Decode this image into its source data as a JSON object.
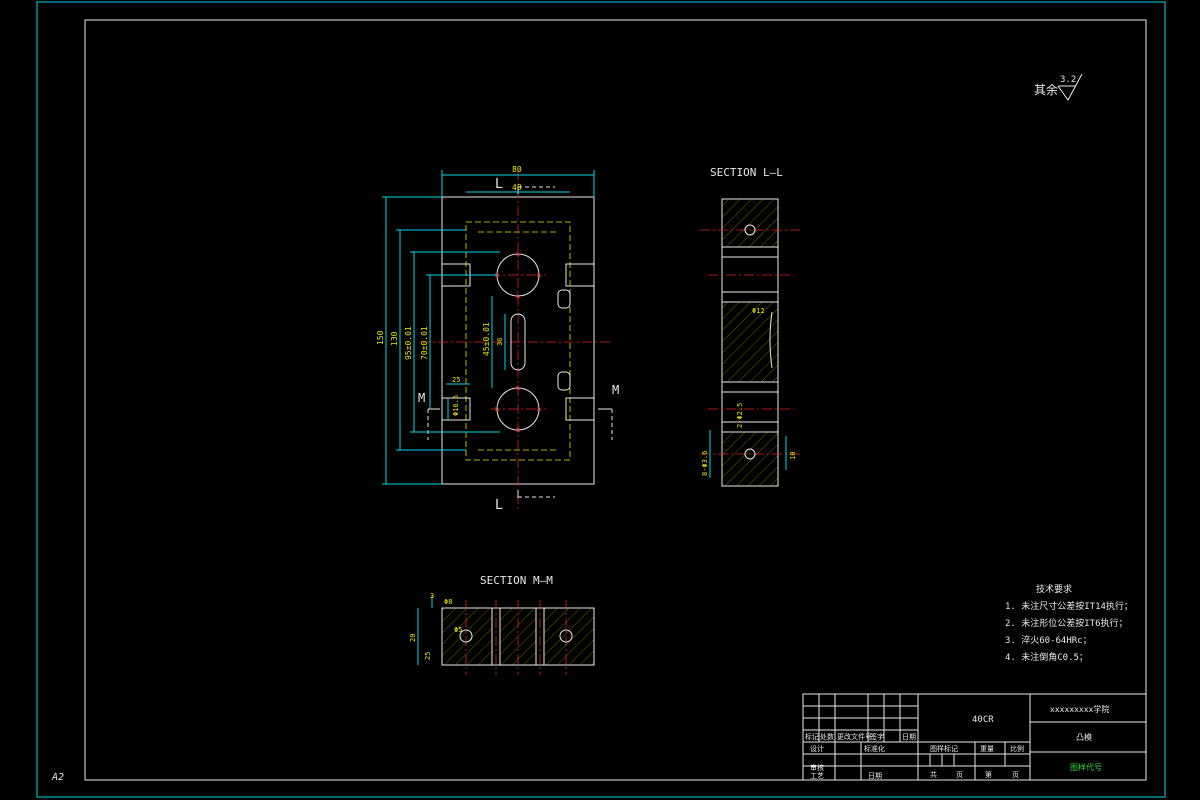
{
  "sheet": {
    "size_label": "A2",
    "roughness_prefix": "其余",
    "roughness_value": "3.2"
  },
  "views": {
    "main": {
      "cut_label_top": "L",
      "cut_label_bottom": "L",
      "cut_label_left": "M",
      "cut_label_right": "M",
      "dims": {
        "width_total": "80",
        "width_inner": "48",
        "height_total": "150",
        "height_2": "130",
        "height_3": "95±0.01",
        "height_4": "70±0.01",
        "slot_pitch": "45±0.01",
        "slot_len": "36",
        "small_1": "25",
        "small_2": "Φ16.5"
      }
    },
    "section_ll": {
      "title": "SECTION  L—L",
      "dims": {
        "d1": "Φ12",
        "d2": "2-Φ2.5",
        "d3": "8-Φ3.6",
        "d4": "10"
      }
    },
    "section_mm": {
      "title": "SECTION  M—M",
      "dims": {
        "d1": "3",
        "d2": "20",
        "d3": "25",
        "d4": "Φ8",
        "d5": "Φ5"
      }
    }
  },
  "tech_requirements": {
    "title": "技术要求",
    "items": [
      "1. 未注尺寸公差按IT14执行；",
      "2. 未注形位公差按IT6执行；",
      "3. 淬火60-64HRc；",
      "4. 未注倒角C0.5；"
    ]
  },
  "title_block": {
    "material": "40CR",
    "school": "xxxxxxxxx学院",
    "part_name": "凸模",
    "drawing_no": "图样代号",
    "headers": [
      "标记",
      "处数",
      "更改文件号",
      "签字",
      "日期"
    ],
    "row_design": "设计",
    "row_std": "标准化",
    "row_check": "审核",
    "row_process": "工艺",
    "row_date": "日期",
    "stage_mark": "图样标记",
    "weight": "重量",
    "scale": "比例",
    "total": "共",
    "page": "页",
    "sheet": "第",
    "sheet_page": "页"
  }
}
